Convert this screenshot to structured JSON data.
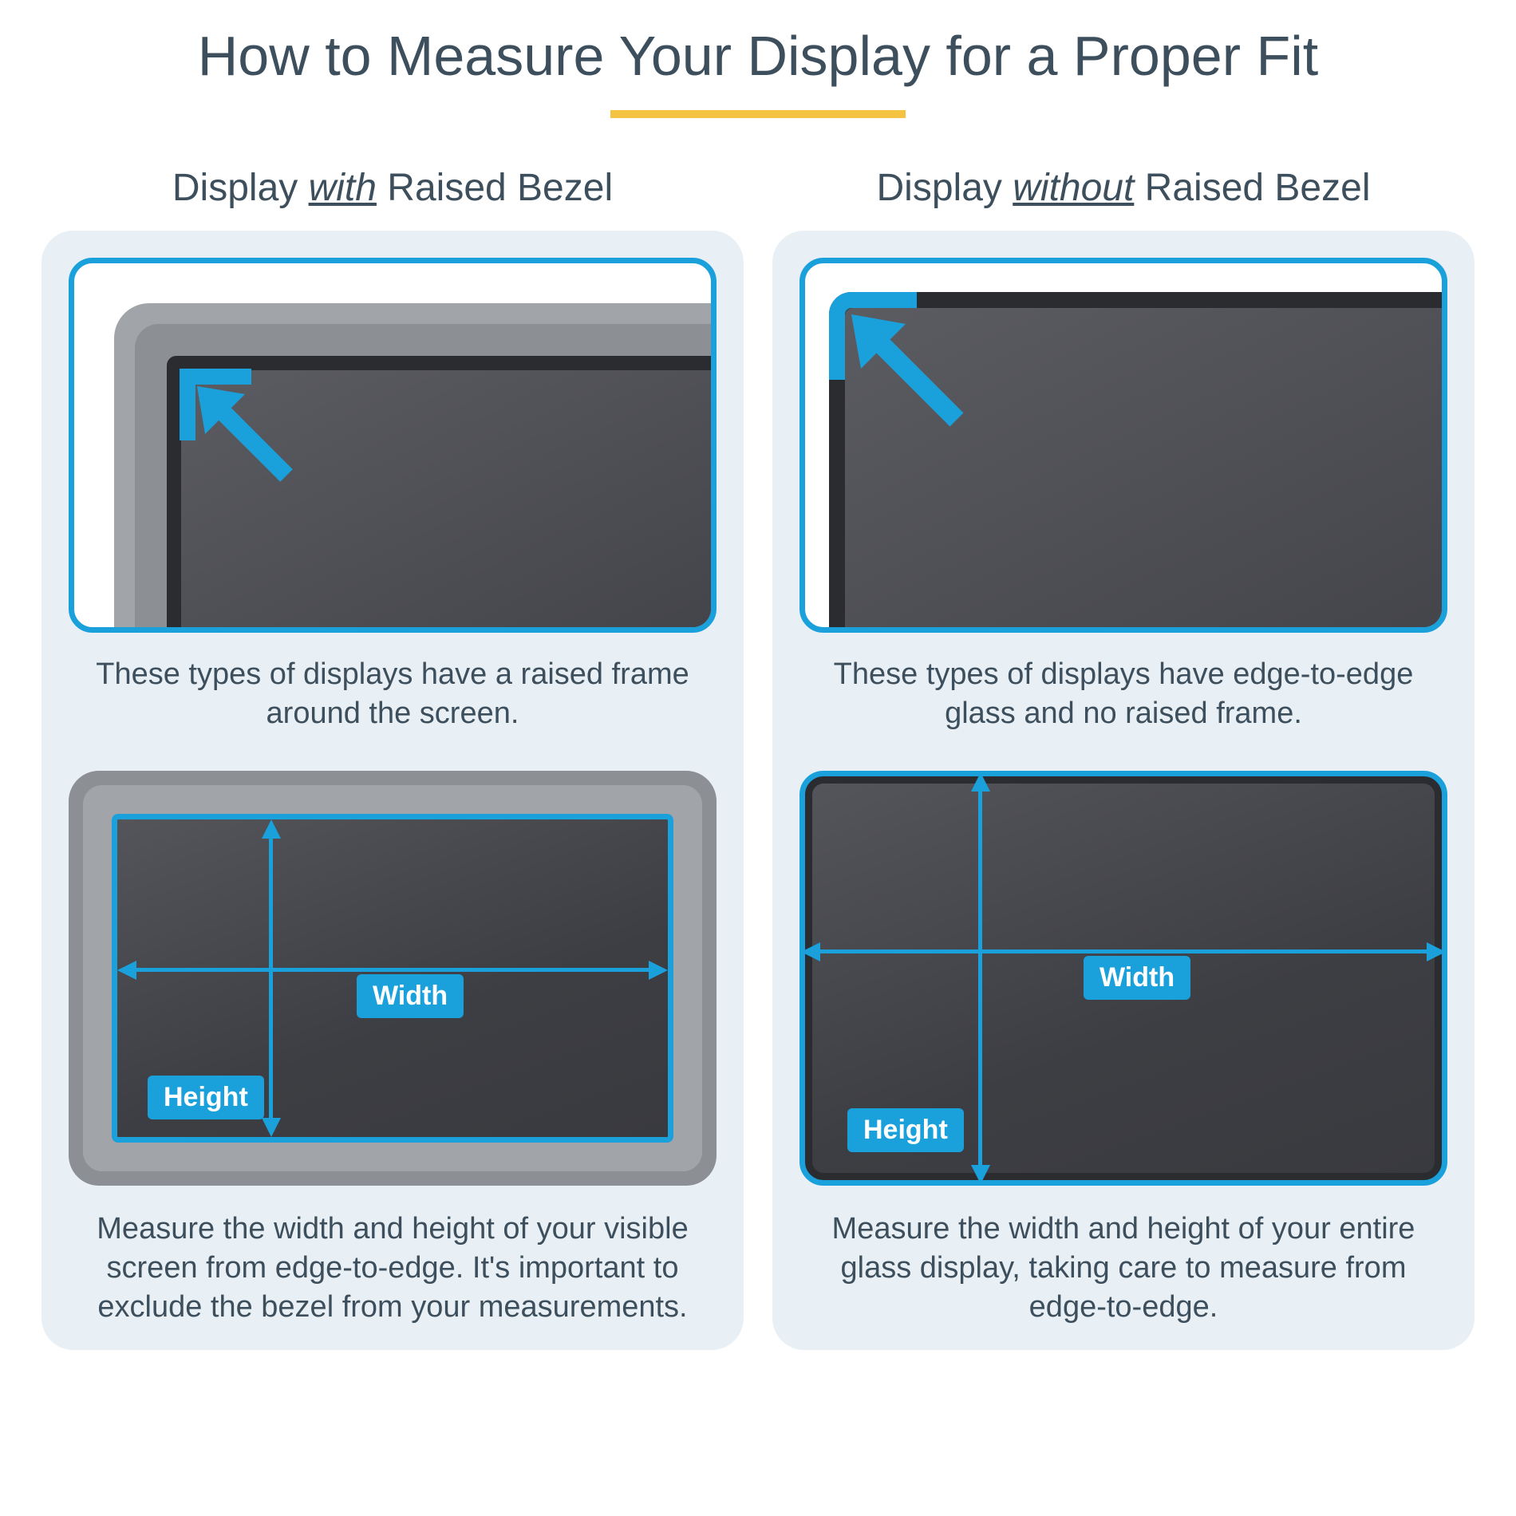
{
  "title": "How to Measure Your Display for a Proper Fit",
  "left": {
    "heading_pre": "Display ",
    "heading_em": "with",
    "heading_post": " Raised Bezel",
    "caption_top": "These types of displays have a raised frame around the screen.",
    "caption_bottom": "Measure the width and height of your visible screen from edge-to-edge. It's important to exclude the bezel from your measurements.",
    "width_label": "Width",
    "height_label": "Height"
  },
  "right": {
    "heading_pre": "Display ",
    "heading_em": "without",
    "heading_post": " Raised Bezel",
    "caption_top": "These types of displays have edge-to-edge glass and no raised frame.",
    "caption_bottom": "Measure the width and height of your entire glass display, taking care to measure from edge-to-edge.",
    "width_label": "Width",
    "height_label": "Height"
  }
}
